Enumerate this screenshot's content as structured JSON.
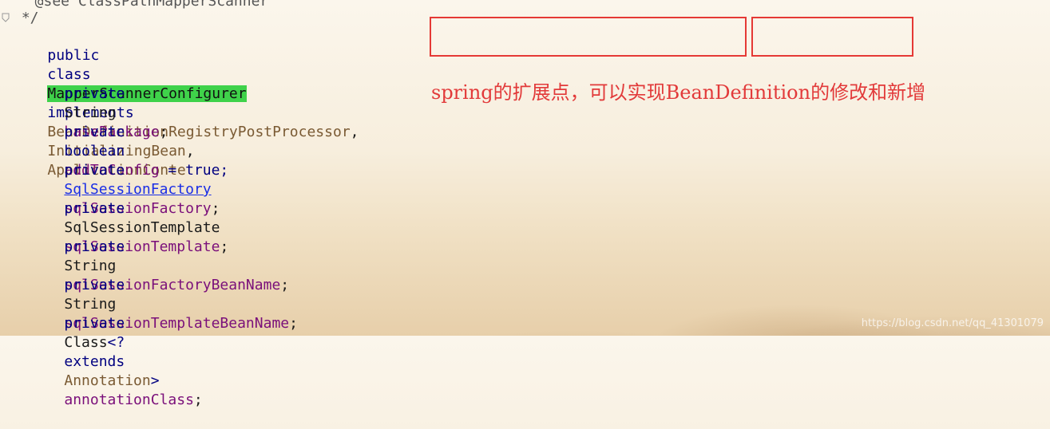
{
  "code": {
    "line_see": "  @see ClassPathMapperScanner",
    "line_end_comment": " */",
    "decl": {
      "kw_public": "public",
      "kw_class": "class",
      "class_name": "MapperScannerConfigurer",
      "kw_implements": "implements",
      "iface1": "BeanDefinitionRegistryPostProcessor",
      "comma1": ",",
      "iface2": "InitializingBean",
      "comma2": ",",
      "iface3": "ApplicationConte"
    },
    "fields": [
      {
        "mod": "private",
        "type": "String",
        "name": "basePackage",
        "rest": ";"
      },
      {
        "mod": "private",
        "type": "boolean",
        "name": "addToConfig",
        "rest": " = true;"
      },
      {
        "mod": "private",
        "type": "SqlSessionFactory",
        "name": "sqlSessionFactory",
        "rest": ";"
      },
      {
        "mod": "private",
        "type": "SqlSessionTemplate",
        "name": "sqlSessionTemplate",
        "rest": ";"
      },
      {
        "mod": "private",
        "type": "String",
        "name": "sqlSessionFactoryBeanName",
        "rest": ";"
      },
      {
        "mod": "private",
        "type": "String",
        "name": "sqlSessionTemplateBeanName",
        "rest": ";"
      }
    ],
    "last_field": {
      "mod": "private",
      "type": "Class",
      "generic_open": "<?",
      "kw_extends": "extends",
      "bound": "Annotation",
      "generic_close": ">",
      "name": "annotationClass",
      "rest": ";"
    }
  },
  "annotation_note": "spring的扩展点，可以实现BeanDefinition的修改和新增",
  "watermark": "https://blog.csdn.net/qq_41301079",
  "colors": {
    "highlight": "#3fd24a",
    "annotation_red": "#e23a3a",
    "keyword": "#000080",
    "field": "#7a0f7a"
  }
}
